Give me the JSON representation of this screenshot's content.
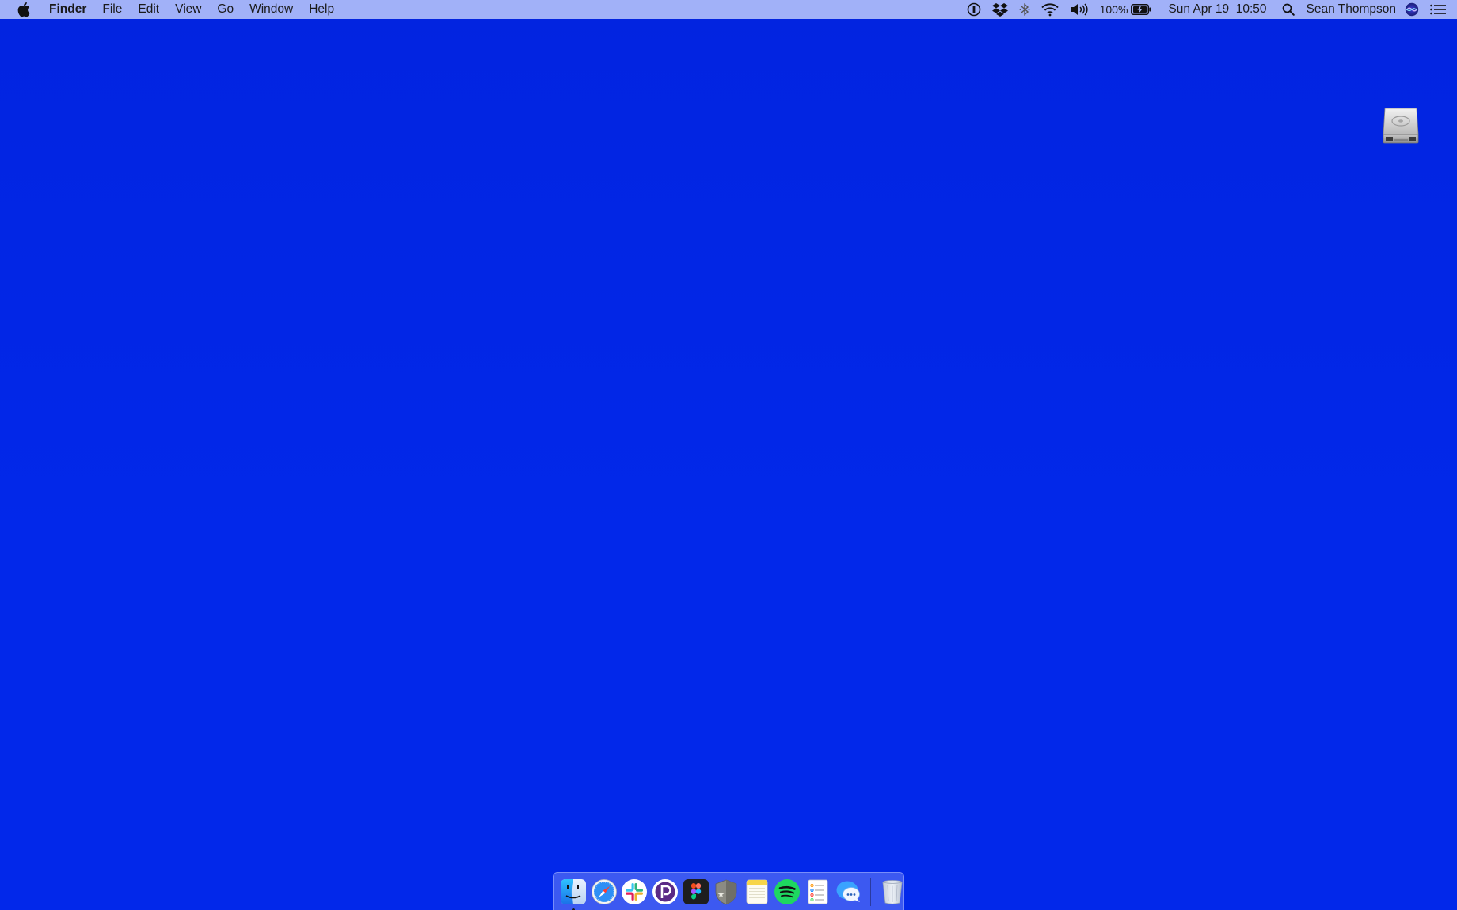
{
  "colors": {
    "desktop_background": "#0226e6",
    "menubar_background": "#afbefa"
  },
  "menubar": {
    "apple_icon": "apple-logo-icon",
    "app_name": "Finder",
    "menus": [
      "File",
      "Edit",
      "View",
      "Go",
      "Window",
      "Help"
    ],
    "status_icons": [
      "1password-icon",
      "dropbox-icon",
      "bluetooth-icon",
      "wifi-icon",
      "volume-icon"
    ],
    "battery_percent": "100%",
    "battery_icon": "battery-charging-icon",
    "datetime": "Sun Apr 19  10:50",
    "spotlight_icon": "spotlight-search-icon",
    "user_name": "Sean Thompson",
    "siri_icon": "siri-icon",
    "notification_icon": "notification-center-icon"
  },
  "desktop": {
    "drive_icon": "hard-drive-icon"
  },
  "dock": {
    "apps": [
      {
        "name": "Finder",
        "icon": "finder-icon",
        "running": true
      },
      {
        "name": "Safari",
        "icon": "safari-icon",
        "running": false
      },
      {
        "name": "Slack",
        "icon": "slack-icon",
        "running": false
      },
      {
        "name": "Pocket Casts",
        "icon": "pocketcasts-icon",
        "running": false
      },
      {
        "name": "Figma",
        "icon": "figma-icon",
        "running": false
      },
      {
        "name": "Security",
        "icon": "shield-icon",
        "running": false
      },
      {
        "name": "Notes",
        "icon": "notes-icon",
        "running": false
      },
      {
        "name": "Spotify",
        "icon": "spotify-icon",
        "running": false
      },
      {
        "name": "Reminders",
        "icon": "reminders-icon",
        "running": false
      },
      {
        "name": "Messages",
        "icon": "messages-icon",
        "running": false
      }
    ],
    "trash": {
      "name": "Trash",
      "icon": "trash-icon"
    }
  }
}
